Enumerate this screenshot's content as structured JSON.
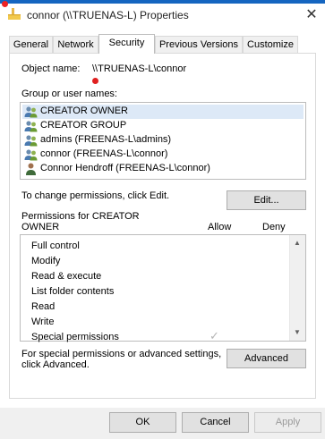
{
  "window": {
    "title": "connor (\\\\TRUENAS-L) Properties",
    "close_glyph": "✕",
    "accent_color": "#1565c0",
    "folder_icon": "folder-icon"
  },
  "tabs": [
    {
      "label": "General",
      "active": false
    },
    {
      "label": "Network",
      "active": false
    },
    {
      "label": "Security",
      "active": true
    },
    {
      "label": "Previous Versions",
      "active": false
    },
    {
      "label": "Customize",
      "active": false
    }
  ],
  "security": {
    "object_name_label": "Object name:",
    "object_name_value": "\\\\TRUENAS-L\\connor",
    "group_label": "Group or user names:",
    "principals": [
      {
        "name": "CREATOR OWNER",
        "icon": "group-icon",
        "selected": true
      },
      {
        "name": "CREATOR GROUP",
        "icon": "group-icon",
        "selected": false
      },
      {
        "name": "admins (FREENAS-L\\admins)",
        "icon": "group-icon",
        "selected": false
      },
      {
        "name": "connor (FREENAS-L\\connor)",
        "icon": "group-icon",
        "selected": false
      },
      {
        "name": "Connor Hendroff (FREENAS-L\\connor)",
        "icon": "user-icon",
        "selected": false
      }
    ],
    "change_text": "To change permissions, click Edit.",
    "edit_button": "Edit...",
    "permissions_for_line1": "Permissions for CREATOR",
    "permissions_for_line2": "OWNER",
    "allow_header": "Allow",
    "deny_header": "Deny",
    "permissions": [
      "Full control",
      "Modify",
      "Read & execute",
      "List folder contents",
      "Read",
      "Write",
      "Special permissions"
    ],
    "special_allow_checked": true,
    "advanced_text_line1": "For special permissions or advanced settings,",
    "advanced_text_line2": "click Advanced.",
    "advanced_button": "Advanced"
  },
  "footer": {
    "ok": "OK",
    "cancel": "Cancel",
    "apply": "Apply",
    "apply_disabled": true
  }
}
